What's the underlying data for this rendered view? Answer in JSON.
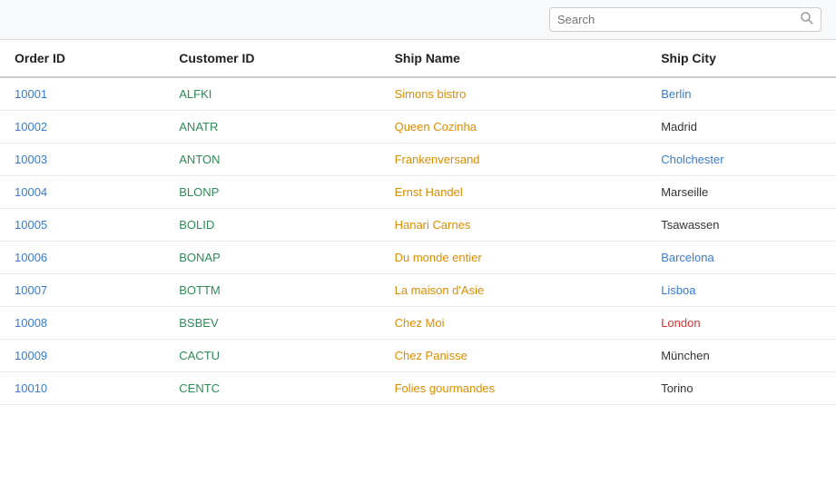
{
  "search": {
    "placeholder": "Search"
  },
  "table": {
    "columns": [
      {
        "key": "orderId",
        "label": "Order ID"
      },
      {
        "key": "customerId",
        "label": "Customer ID"
      },
      {
        "key": "shipName",
        "label": "Ship Name"
      },
      {
        "key": "shipCity",
        "label": "Ship City"
      }
    ],
    "rows": [
      {
        "orderId": "10001",
        "customerId": "ALFKI",
        "shipName": "Simons bistro",
        "shipCity": "Berlin",
        "cityStyle": "blue"
      },
      {
        "orderId": "10002",
        "customerId": "ANATR",
        "shipName": "Queen Cozinha",
        "shipCity": "Madrid",
        "cityStyle": "dark"
      },
      {
        "orderId": "10003",
        "customerId": "ANTON",
        "shipName": "Frankenversand",
        "shipCity": "Cholchester",
        "cityStyle": "blue"
      },
      {
        "orderId": "10004",
        "customerId": "BLONP",
        "shipName": "Ernst Handel",
        "shipCity": "Marseille",
        "cityStyle": "dark"
      },
      {
        "orderId": "10005",
        "customerId": "BOLID",
        "shipName": "Hanari Carnes",
        "shipCity": "Tsawassen",
        "cityStyle": "dark"
      },
      {
        "orderId": "10006",
        "customerId": "BONAP",
        "shipName": "Du monde entier",
        "shipCity": "Barcelona",
        "cityStyle": "blue"
      },
      {
        "orderId": "10007",
        "customerId": "BOTTM",
        "shipName": "La maison d'Asie",
        "shipCity": "Lisboa",
        "cityStyle": "blue"
      },
      {
        "orderId": "10008",
        "customerId": "BSBEV",
        "shipName": "Chez Moi",
        "shipCity": "London",
        "cityStyle": "red"
      },
      {
        "orderId": "10009",
        "customerId": "CACTU",
        "shipName": "Chez Panisse",
        "shipCity": "München",
        "cityStyle": "dark"
      },
      {
        "orderId": "10010",
        "customerId": "CENTC",
        "shipName": "Folies gourmandes",
        "shipCity": "Torino",
        "cityStyle": "dark"
      }
    ]
  }
}
